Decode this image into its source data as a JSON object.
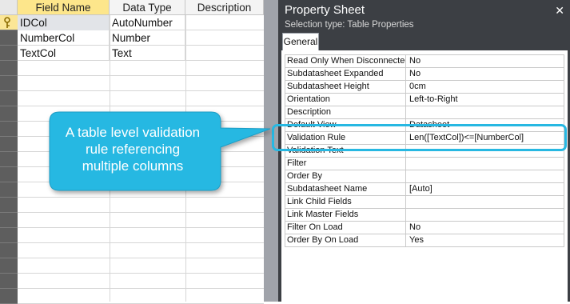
{
  "design": {
    "headers": [
      "Field Name",
      "Data Type",
      "Description"
    ],
    "rows": [
      {
        "field": "IDCol",
        "type": "AutoNumber",
        "key_icon": "primary-key-icon"
      },
      {
        "field": "NumberCol",
        "type": "Number"
      },
      {
        "field": "TextCol",
        "type": "Text"
      }
    ]
  },
  "property_sheet": {
    "title": "Property Sheet",
    "close_glyph": "✕",
    "selection_type": "Selection type:  Table Properties",
    "tab": "General",
    "properties": [
      {
        "name": "Read Only When Disconnected",
        "value": "No"
      },
      {
        "name": "Subdatasheet Expanded",
        "value": "No"
      },
      {
        "name": "Subdatasheet Height",
        "value": "0cm"
      },
      {
        "name": "Orientation",
        "value": "Left-to-Right"
      },
      {
        "name": "Description",
        "value": ""
      },
      {
        "name": "Default View",
        "value": "Datasheet"
      },
      {
        "name": "Validation Rule",
        "value": "Len([TextCol])<=[NumberCol]"
      },
      {
        "name": "Validation Text",
        "value": ""
      },
      {
        "name": "Filter",
        "value": ""
      },
      {
        "name": "Order By",
        "value": ""
      },
      {
        "name": "Subdatasheet Name",
        "value": "[Auto]"
      },
      {
        "name": "Link Child Fields",
        "value": ""
      },
      {
        "name": "Link Master Fields",
        "value": ""
      },
      {
        "name": "Filter On Load",
        "value": "No"
      },
      {
        "name": "Order By On Load",
        "value": "Yes"
      }
    ]
  },
  "callout": {
    "text": "A table level validation rule referencing multiple columns",
    "line1": "A table level validation",
    "line2": "rule referencing",
    "line3": "multiple columns",
    "color": "#27b8e2"
  },
  "colors": {
    "accent": "#27b8e2",
    "selected_header": "#fde68b",
    "property_frame": "#3c3f44"
  }
}
